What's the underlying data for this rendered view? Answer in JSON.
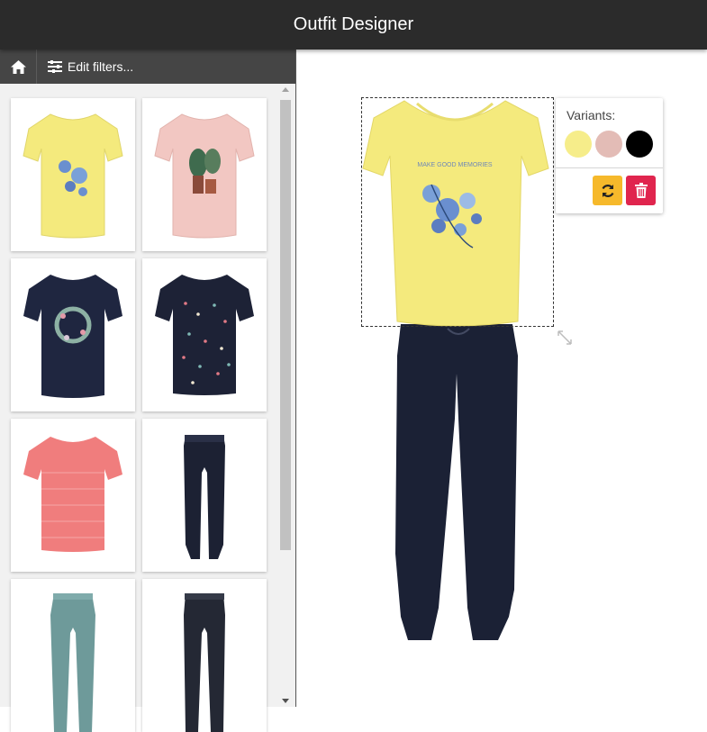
{
  "app": {
    "title": "Outfit Designer"
  },
  "sidebar": {
    "home_icon": "home-icon",
    "filter_icon": "sliders-icon",
    "filter_label": "Edit filters...",
    "products": [
      {
        "name": "product-yellow-floral-tshirt",
        "color": "#f4ea7d",
        "kind": "tshirt"
      },
      {
        "name": "product-pink-leaf-tshirt",
        "color": "#f2c7c2",
        "kind": "tshirt"
      },
      {
        "name": "product-navy-wreath-tshirt",
        "color": "#1f2640",
        "kind": "tshirt"
      },
      {
        "name": "product-navy-dotted-tshirt",
        "color": "#1d2236",
        "kind": "tshirt"
      },
      {
        "name": "product-coral-striped-tshirt",
        "color": "#f07d7d",
        "kind": "tshirt"
      },
      {
        "name": "product-navy-jogger-pants",
        "color": "#1c2133",
        "kind": "pants"
      },
      {
        "name": "product-teal-pants",
        "color": "#6e9a9a",
        "kind": "pants"
      },
      {
        "name": "product-dark-denim-pants",
        "color": "#242834",
        "kind": "pants"
      }
    ]
  },
  "canvas": {
    "top_item_color": "#f4ea7d",
    "top_print_text": "MAKE GOOD MEMORIES",
    "bottom_item_color": "#1b2135"
  },
  "variants": {
    "label": "Variants:",
    "swatches": [
      "#f6ed8a",
      "#e3bcb6",
      "#000000"
    ],
    "swap_icon": "refresh-icon",
    "delete_icon": "trash-icon",
    "swap_color": "#f6b92b",
    "delete_color": "#e0254e"
  }
}
